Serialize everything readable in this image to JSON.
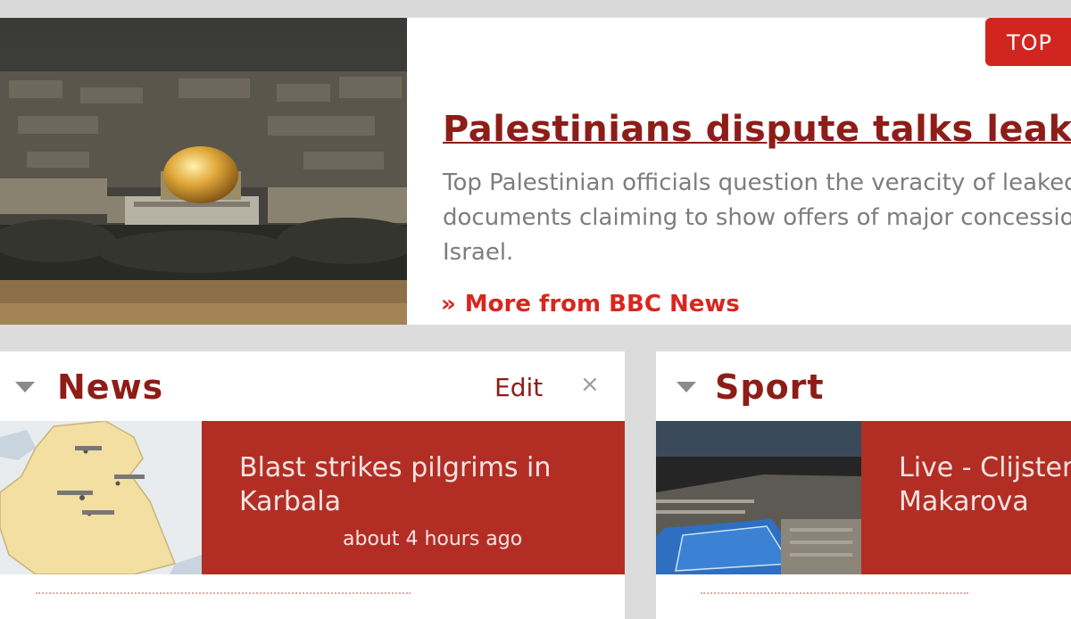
{
  "top_story": {
    "badge": "TOP",
    "headline": "Palestinians dispute talks leak",
    "summary": "Top Palestinian officials question the veracity of leaked documents claiming to show offers of major concessions to Israel.",
    "more_link": "More from BBC News",
    "more_icon": "double-chevron-right-icon",
    "image_subject": "Jerusalem skyline with the Dome of the Rock"
  },
  "modules": {
    "news": {
      "title": "News",
      "edit_label": "Edit",
      "close_symbol": "×",
      "story": {
        "headline": "Blast strikes pilgrims in Karbala",
        "time": "about 4 hours ago",
        "image_subject": "map of Iraq"
      }
    },
    "sport": {
      "title": "Sport",
      "story": {
        "headline": "Live - Clijsters v Makarova",
        "image_subject": "tennis stadium"
      }
    }
  },
  "colors": {
    "brand_red": "#d1261f",
    "title_red": "#8e1d17",
    "panel_red": "#b22e25",
    "summary_grey": "#7d7d7d"
  }
}
